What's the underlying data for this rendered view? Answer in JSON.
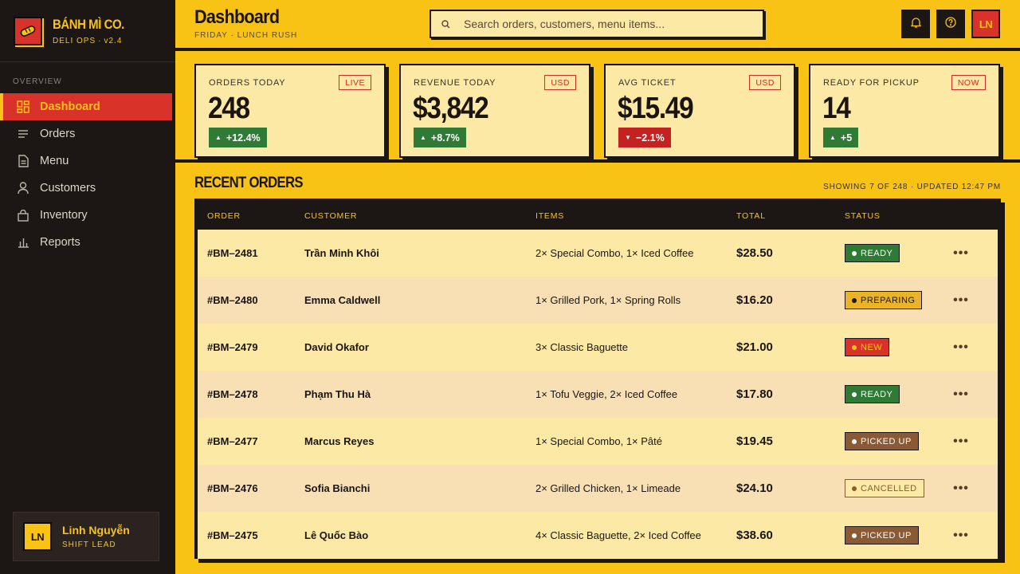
{
  "brand": {
    "name": "BÁNH MÌ CO.",
    "app": "DELI OPS",
    "version": "v2.4"
  },
  "sidebar": {
    "section": "OVERVIEW",
    "items": [
      {
        "label": "Dashboard",
        "icon": "dashboard-icon",
        "active": true
      },
      {
        "label": "Orders",
        "icon": "list-icon"
      },
      {
        "label": "Menu",
        "icon": "document-icon"
      },
      {
        "label": "Customers",
        "icon": "user-icon"
      },
      {
        "label": "Inventory",
        "icon": "bag-icon"
      },
      {
        "label": "Reports",
        "icon": "bar-chart-icon"
      }
    ],
    "user": {
      "initials": "LN",
      "name": "Linh Nguyễn",
      "role": "SHIFT LEAD"
    }
  },
  "header": {
    "title": "Dashboard",
    "day": "FRIDAY",
    "shift": "LUNCH RUSH",
    "search_placeholder": "Search orders, customers, menu items...",
    "avatar_initials": "LN"
  },
  "kpis": [
    {
      "label": "ORDERS TODAY",
      "tag": "LIVE",
      "value": "248",
      "delta": "+12.4%",
      "trend": "up"
    },
    {
      "label": "REVENUE TODAY",
      "tag": "USD",
      "value": "$3,842",
      "delta": "+8.7%",
      "trend": "up"
    },
    {
      "label": "AVG TICKET",
      "tag": "USD",
      "value": "$15.49",
      "delta": "−2.1%",
      "trend": "down"
    },
    {
      "label": "READY FOR PICKUP",
      "tag": "NOW",
      "value": "14",
      "delta": "+5",
      "trend": "up"
    }
  ],
  "orders": {
    "title": "RECENT ORDERS",
    "showing": "SHOWING 7 OF 248",
    "updated": "UPDATED 12:47 PM",
    "columns": [
      "ORDER",
      "CUSTOMER",
      "ITEMS",
      "TOTAL",
      "STATUS"
    ],
    "rows": [
      {
        "id": "#BM–2481",
        "customer": "Trần Minh Khôi",
        "items": "2× Special Combo, 1× Iced Coffee",
        "total": "$28.50",
        "status": "READY"
      },
      {
        "id": "#BM–2480",
        "customer": "Emma Caldwell",
        "items": "1× Grilled Pork, 1× Spring Rolls",
        "total": "$16.20",
        "status": "PREPARING"
      },
      {
        "id": "#BM–2479",
        "customer": "David Okafor",
        "items": "3× Classic Baguette",
        "total": "$21.00",
        "status": "NEW"
      },
      {
        "id": "#BM–2478",
        "customer": "Phạm Thu Hà",
        "items": "1× Tofu Veggie, 2× Iced Coffee",
        "total": "$17.80",
        "status": "READY"
      },
      {
        "id": "#BM–2477",
        "customer": "Marcus Reyes",
        "items": "1× Special Combo, 1× Pâté",
        "total": "$19.45",
        "status": "PICKED UP"
      },
      {
        "id": "#BM–2476",
        "customer": "Sofia Bianchi",
        "items": "2× Grilled Chicken, 1× Limeade",
        "total": "$24.10",
        "status": "CANCELLED"
      },
      {
        "id": "#BM–2475",
        "customer": "Lê Quốc Bào",
        "items": "4× Classic Baguette, 2× Iced Coffee",
        "total": "$38.60",
        "status": "PICKED UP"
      }
    ]
  },
  "colors": {
    "accent_yellow": "#f9c315",
    "sidebar_bg": "#1c1714",
    "active_red": "#d8322a",
    "card_bg": "#fde9a6",
    "up_green": "#2f7a34",
    "down_red": "#c42222",
    "status": {
      "READY": {
        "bg": "#2f7a34",
        "fg": "#ffffff",
        "dot": "#ffffff"
      },
      "PREPARING": {
        "bg": "#e9b42a",
        "fg": "#1c1714",
        "dot": "#1c1714"
      },
      "NEW": {
        "bg": "#d8322a",
        "fg": "#f9c315",
        "dot": "#f9c315"
      },
      "PICKED UP": {
        "bg": "#8a5a35",
        "fg": "#ffffff",
        "dot": "#ffffff"
      },
      "CANCELLED": {
        "bg": "#fde9a6",
        "fg": "#8a5a35",
        "dot": "#8a5a35"
      }
    }
  }
}
